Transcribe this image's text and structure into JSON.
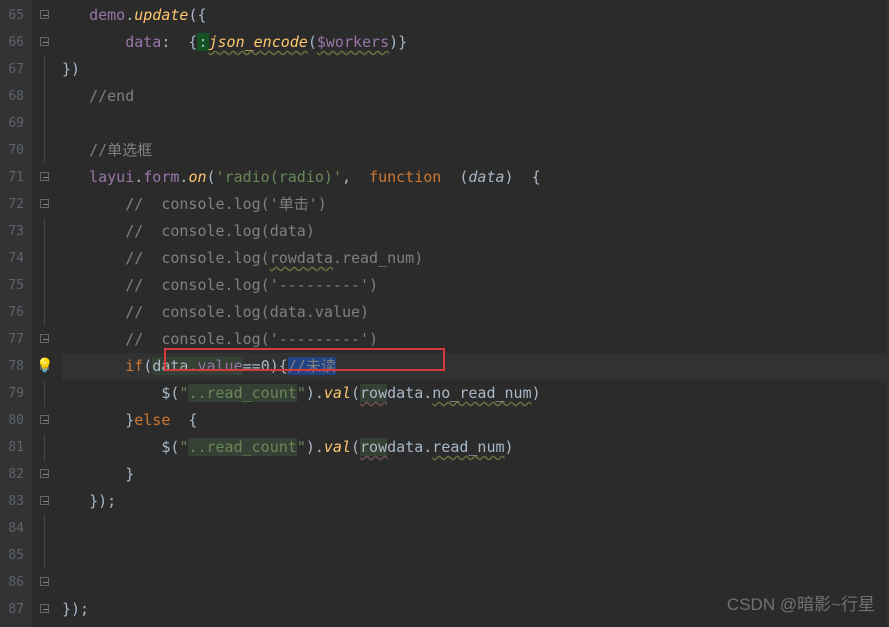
{
  "gutter": {
    "start": 65,
    "end": 87
  },
  "watermark": "CSDN @暗影~行星",
  "code": {
    "l65": {
      "prop": "demo",
      "fn": "update"
    },
    "l66": {
      "prop1": "data",
      "fn": "json_encode",
      "var": "$workers",
      "colon": ":"
    },
    "l67": {
      "text": "})"
    },
    "l68": {
      "cmt": "//end"
    },
    "l70": {
      "cmt": "//单选框"
    },
    "l71": {
      "obj1": "layui",
      "obj2": "form",
      "fn": "on",
      "str": "radio(radio)",
      "kw": "function",
      "param": "data"
    },
    "l72": {
      "cmt": "//  console.log('单击')"
    },
    "l73": {
      "cmt": "//  console.log(data)"
    },
    "l74": {
      "cmt1": "//  console.log(",
      "warn": "rowdata",
      "cmt2": ".read_num)"
    },
    "l75": {
      "cmt": "//  console.log('---------')"
    },
    "l76": {
      "cmt": "//  console.log(data.value)"
    },
    "l77": {
      "cmt": "//  console.log('---------')"
    },
    "l78": {
      "kw": "if",
      "obj": "data",
      "prop": "value",
      "op": "==",
      "val": "0",
      "cmt": "//未读"
    },
    "l79": {
      "dollar": "$",
      "str": ".read_count",
      "fn": "val",
      "hl": "row",
      "obj": "data.",
      "warn": "no_read_num"
    },
    "l80": {
      "kw": "else"
    },
    "l81": {
      "dollar": "$",
      "str": ".read_count",
      "fn": "val",
      "hl": "row",
      "obj": "data.",
      "warn": "read_num"
    },
    "l82": {
      "brace": "}"
    },
    "l83": {
      "text": "});"
    },
    "l87": {
      "text": "});"
    }
  }
}
